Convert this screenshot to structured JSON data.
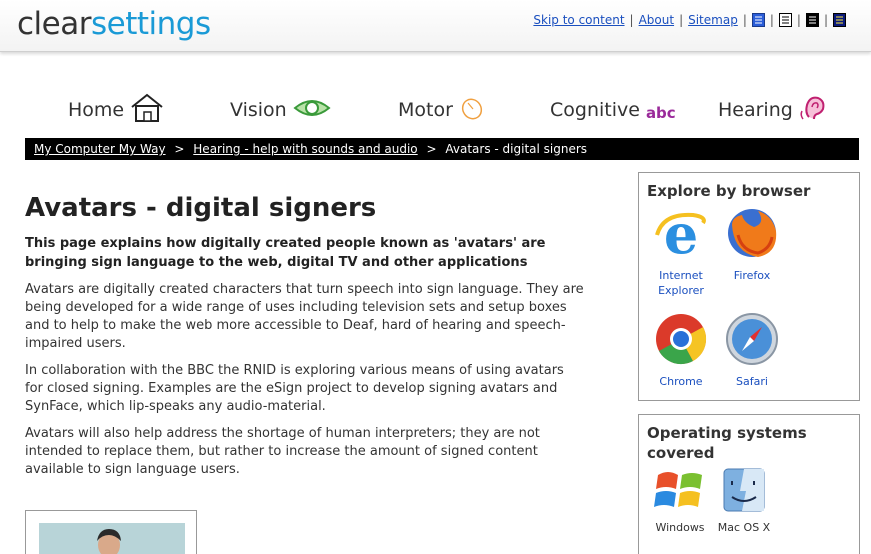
{
  "header": {
    "logo_part1": "clear",
    "logo_part2": "settings",
    "links": {
      "skip": "Skip to content",
      "about": "About",
      "sitemap": "Sitemap"
    },
    "separator": "|"
  },
  "nav": {
    "home": "Home",
    "vision": "Vision",
    "motor": "Motor",
    "cognitive": "Cognitive",
    "cognitive_badge": "abc",
    "hearing": "Hearing"
  },
  "breadcrumb": {
    "item1": "My Computer My Way",
    "item2": "Hearing - help with sounds and audio",
    "current": "Avatars - digital signers",
    "sep": ">"
  },
  "main": {
    "title": "Avatars - digital signers",
    "intro": "This page explains how digitally created people known as 'avatars' are bringing sign language to the web, digital TV and other applications",
    "para1": "Avatars are digitally created characters that turn speech into sign language. They are being developed for a wide range of uses including television sets and setup boxes and to help to make the web more accessible to Deaf, hard of hearing and speech-impaired users.",
    "para2": "In collaboration with the BBC the RNID is exploring various means of using avatars for closed signing. Examples are the eSign project to develop signing avatars and SynFace, which lip-speaks any audio-material.",
    "para3": "Avatars will also help address the shortage of human interpreters; they are not intended to replace them, but rather to increase the amount of signed content available to sign language users."
  },
  "sidebar": {
    "browsers": {
      "title": "Explore by browser",
      "items": [
        "Internet Explorer",
        "Firefox",
        "Chrome",
        "Safari"
      ]
    },
    "os": {
      "title": "Operating systems covered",
      "items": [
        "Windows",
        "Mac OS X"
      ]
    }
  },
  "colors": {
    "brand_blue": "#1a9ad6",
    "link": "#1a4fbf",
    "breadcrumb_bg": "#000000"
  }
}
